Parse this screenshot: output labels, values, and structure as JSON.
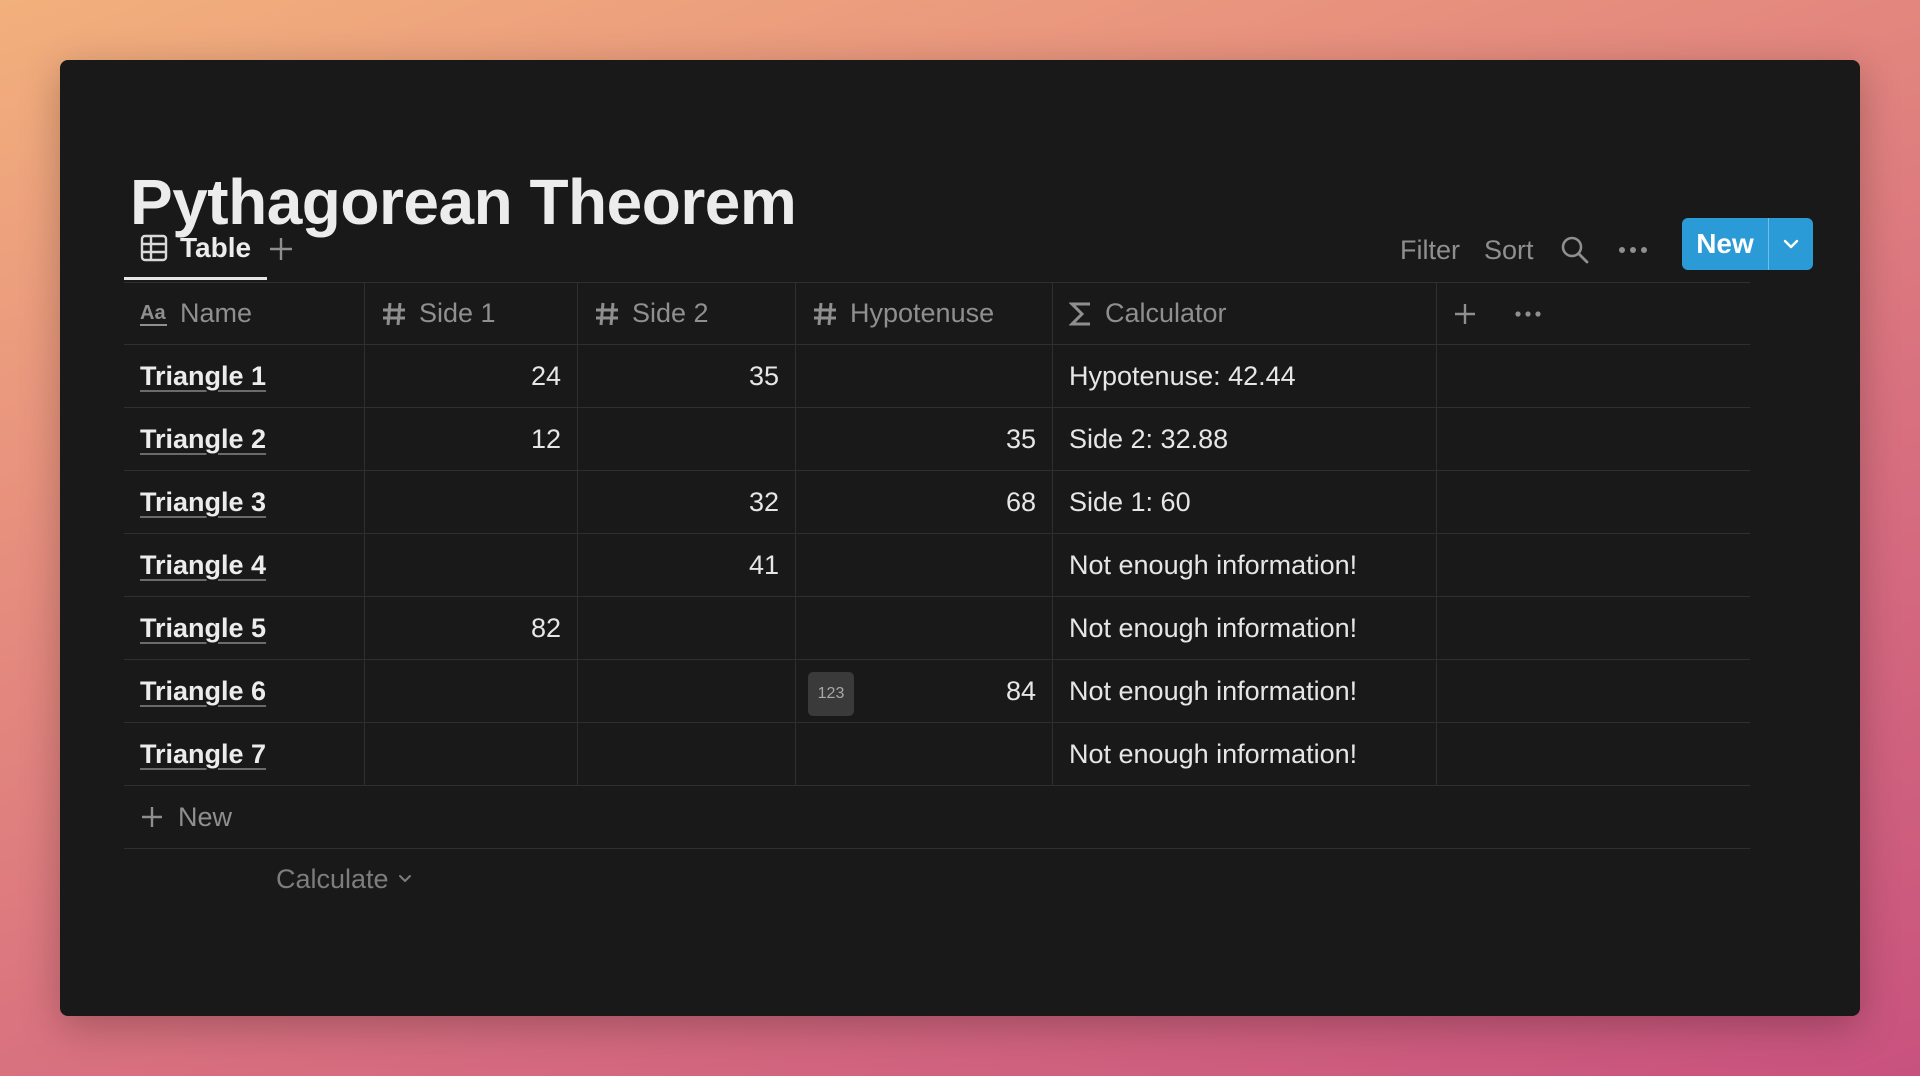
{
  "page": {
    "title": "Pythagorean Theorem"
  },
  "views": {
    "active_tab": "Table"
  },
  "toolbar": {
    "filter_label": "Filter",
    "sort_label": "Sort",
    "new_label": "New"
  },
  "colors": {
    "accent": "#2a9bd6",
    "background": "#191919",
    "border": "#2f2f2f"
  },
  "table": {
    "columns": [
      {
        "label": "Name",
        "icon": "text-aa-icon"
      },
      {
        "label": "Side 1",
        "icon": "hash-icon"
      },
      {
        "label": "Side 2",
        "icon": "hash-icon"
      },
      {
        "label": "Hypotenuse",
        "icon": "hash-icon"
      },
      {
        "label": "Calculator",
        "icon": "sigma-icon"
      }
    ],
    "rows": [
      {
        "name": "Triangle 1",
        "side1": "24",
        "side2": "35",
        "hypotenuse": "",
        "calculator": "Hypotenuse: 42.44"
      },
      {
        "name": "Triangle 2",
        "side1": "12",
        "side2": "",
        "hypotenuse": "35",
        "calculator": "Side 2: 32.88"
      },
      {
        "name": "Triangle 3",
        "side1": "",
        "side2": "32",
        "hypotenuse": "68",
        "calculator": "Side 1: 60"
      },
      {
        "name": "Triangle 4",
        "side1": "",
        "side2": "41",
        "hypotenuse": "",
        "calculator": "Not enough information!"
      },
      {
        "name": "Triangle 5",
        "side1": "82",
        "side2": "",
        "hypotenuse": "",
        "calculator": "Not enough information!"
      },
      {
        "name": "Triangle 6",
        "side1": "",
        "side2": "",
        "hypotenuse": "84",
        "calculator": "Not enough information!",
        "number_badge": "123"
      },
      {
        "name": "Triangle 7",
        "side1": "",
        "side2": "",
        "hypotenuse": "",
        "calculator": "Not enough information!"
      }
    ],
    "new_row_label": "New",
    "calculate_label": "Calculate"
  }
}
